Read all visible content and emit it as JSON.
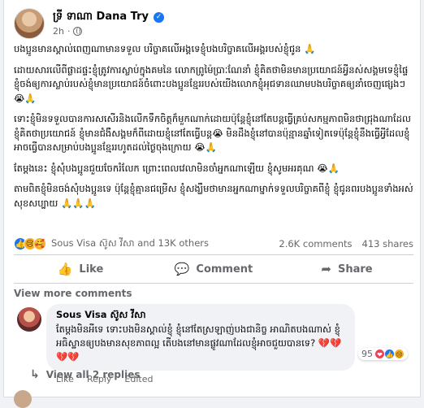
{
  "post": {
    "author": "ទ្រី ទាណា Dana Try",
    "time": "2h",
    "separator": "·",
    "verified_glyph": "✓",
    "paragraphs": [
      "បងប្អូនមានស្គាល់ពេញណាមានទទួល បរិច្ចាគលើអង្គទេខ្ញុំបងបរិច្ចាគលើអង្គរបស់ខ្ញុំជូន 🙏",
      "ដោយសារលើពីផ្លាដផ្ទះខ្ញុំត្រូវការស្លាប់ក្នុងគមនៃ លោកព្រូម៉ៃប្រាៈណែនាំ ខ្ញុំគិតថាមិនមានប្រយោជន៍អ្វីនស់សង្គមទេខ្ញុំផ្ទៃខ្ញុំចង់ឲ្យការស្លាប់របស់ខ្ញុំមានប្រយោជន៍ចំពោះបងប្អូនខ្មែររបស់យើងលោកខ្ញុំអុជទានឈាមបងបរិច្ចាគឲ្យនាំចេញផ្សេងៗ 😭🙏",
      "ទោះខ្ញុំមិនទទួលបានការសសើរនិងលើកទឹកចិត្តក៏មួកណាក់ដោយប៉ុន្តែខ្ញុំនៅតែបន្តធ្វើគ្រប់សកម្មភាពមិនថាជ្រុងណាដែលខ្ញុំគិតថាប្រយោជន៍ ខ្ញុំមានជំងឺសង្គមក៏ពីដោយខ្ញុំនៅតែធ្វើបន្ត😭 មិនដឹងខ្ញុំនៅបានប៉ុន្មានឆ្នាំទៀតទេប៉ុន្តែខ្ញុំនឹងធ្វើអ្វីដែលខ្ញុំអាចធ្វើបានសម្រាប់បងប្អូនខ្មែររហូតដល់ថ្ងៃចុងក្រោយ 😭🙏",
      "តែម្តងនេះ ខ្ញុំសុំបងប្អូនជួយចែករំលែក ព្រោះពេលវេលាមិនចាំអ្នកណាឡើយ ខ្ញុំសូមអរគុណ 😭🙏",
      "តាមពិតខ្ញុំមិនចង់សុំបងប្អូនទេ ប៉ុន្តែខ្ញុំគ្មានជម្រើស ខ្ញុំសង្ឃឹមថាមានអ្នកណាម្នាក់ទទួលបរិច្ចាគពីខ្ញុំ ខ្ញុំជូនពរបងប្អូនទាំងអស់សុខសប្បាយ 🙏🙏🙏"
    ]
  },
  "reactions": {
    "like_glyph": "👍",
    "sad_glyph": "😢",
    "care_glyph": "🥰",
    "summary": "Sous Visa ស៊ូស វីសា and 13K others",
    "comments": "2.6K comments",
    "shares": "413 shares"
  },
  "actions": {
    "like_glyph": "👍",
    "comment_glyph": "💬",
    "share_glyph": "➦",
    "like": "Like",
    "comment": "Comment",
    "share": "Share"
  },
  "view_more": "View more comments",
  "comment": {
    "author": "Sous Visa ស៊ូស វីសា",
    "text": "តែម្តងមិនអីទេ ទោះបងមិនស្គាល់ខ្ញុំ ខ្ញុំនៅតែស្រឡាញ់បងជានិច្ច អាណិតបងណាស់ ខ្ញុំអធិស្ឋានឲ្យបងមានសុខភាពល្អ តើបងនៅមានផ្លូវណាដែលខ្ញុំអាចជួយបានទេ? 💔💔💔💔",
    "like": "Like",
    "reply": "Reply",
    "edited": "Edited",
    "reaction_count": "95",
    "love_glyph": "❤",
    "like_glyph": "👍",
    "sad_glyph": "😢"
  },
  "replies": {
    "arrow_glyph": "↳",
    "label": "View all 2 replies"
  }
}
